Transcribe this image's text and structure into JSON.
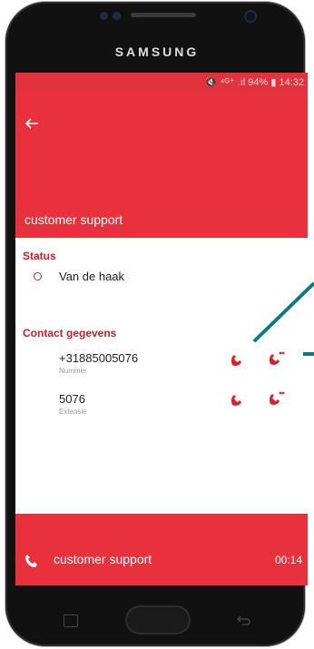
{
  "device": {
    "brand": "SAMSUNG"
  },
  "status_bar": {
    "icons_text": "🔇 ⁴ᴳ⁺ .ıl 94% ▮ 14:32"
  },
  "app_bar": {
    "title": "customer support",
    "back_icon": "arrow-left-icon"
  },
  "status_section": {
    "title": "Status",
    "value": "Van de haak"
  },
  "contact_section": {
    "title": "Contact gegevens",
    "entries": [
      {
        "value": "+31885005076",
        "label": "Nummer"
      },
      {
        "value": "5076",
        "label": "Extensie"
      }
    ]
  },
  "call_bar": {
    "name": "customer support",
    "timer": "00:14"
  },
  "colors": {
    "primary": "#e8313c",
    "accent": "#c4202b",
    "annotation": "#0e7a80"
  }
}
